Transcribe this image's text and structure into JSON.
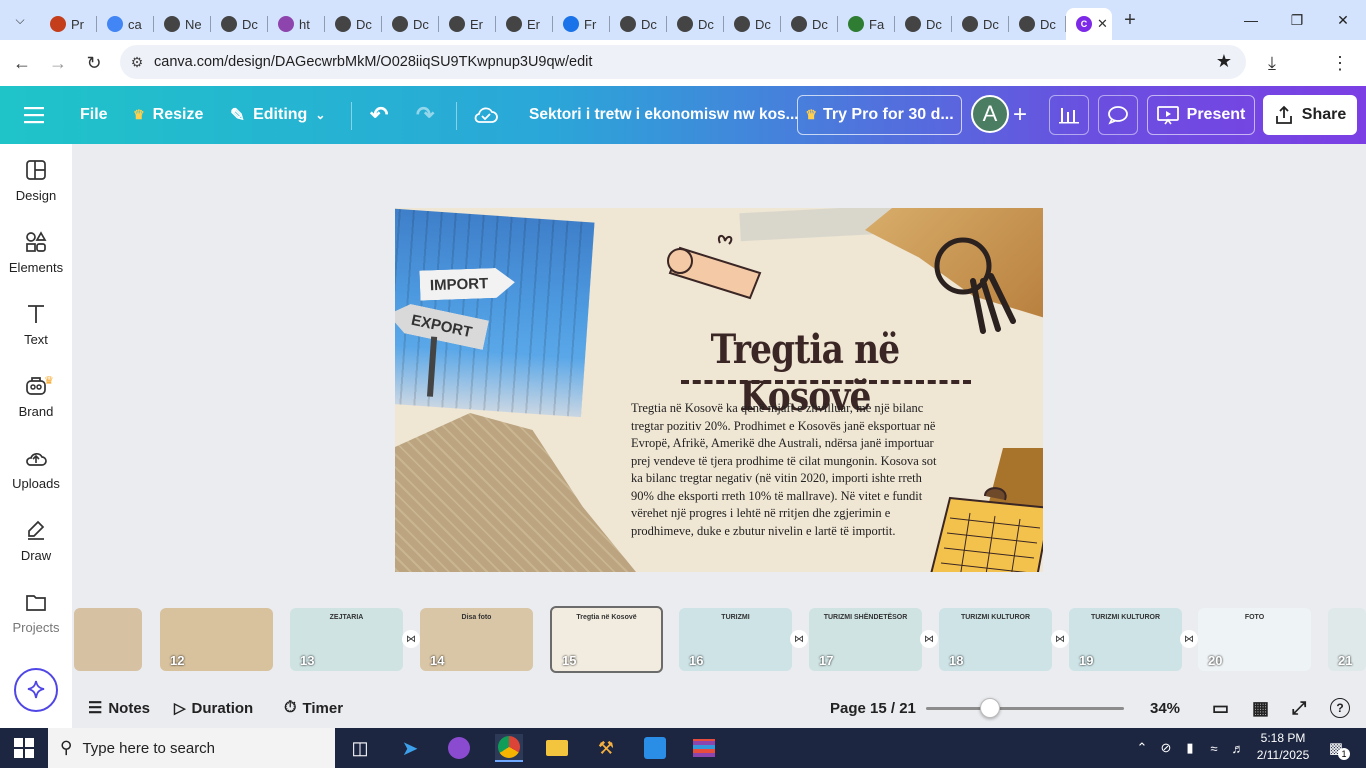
{
  "browser": {
    "tabs": [
      {
        "label": "Pr",
        "icon": "powerpoint-icon",
        "color": "#c43e1c"
      },
      {
        "label": "ca",
        "icon": "google-icon",
        "color": "#4285f4"
      },
      {
        "label": "Ne",
        "icon": "web-icon",
        "color": "#444444"
      },
      {
        "label": "Dc",
        "icon": "web-icon",
        "color": "#444444"
      },
      {
        "label": "ht",
        "icon": "triangle-icon",
        "color": "#8e44ad"
      },
      {
        "label": "Dc",
        "icon": "web-icon",
        "color": "#444444"
      },
      {
        "label": "Dc",
        "icon": "web-icon",
        "color": "#444444"
      },
      {
        "label": "Er",
        "icon": "web-icon",
        "color": "#444444"
      },
      {
        "label": "Er",
        "icon": "web-icon",
        "color": "#444444"
      },
      {
        "label": "Fr",
        "icon": "heart-icon",
        "color": "#1a73e8"
      },
      {
        "label": "Dc",
        "icon": "web-icon",
        "color": "#444444"
      },
      {
        "label": "Dc",
        "icon": "web-icon",
        "color": "#444444"
      },
      {
        "label": "Dc",
        "icon": "web-icon",
        "color": "#444444"
      },
      {
        "label": "Dc",
        "icon": "web-icon",
        "color": "#444444"
      },
      {
        "label": "Fa",
        "icon": "am-icon",
        "color": "#2e7d32"
      },
      {
        "label": "Dc",
        "icon": "web-icon",
        "color": "#444444"
      },
      {
        "label": "Dc",
        "icon": "web-icon",
        "color": "#444444"
      },
      {
        "label": "Dc",
        "icon": "web-icon",
        "color": "#444444"
      }
    ],
    "url": "canva.com/design/DAGecwrbMkM/O028iiqSU9TKwpnup3U9qw/edit"
  },
  "canva_header": {
    "file": "File",
    "resize": "Resize",
    "editing": "Editing",
    "doc_title": "Sektori i tretw i ekonomisw nw kos...",
    "try_pro": "Try Pro for 30 d...",
    "avatar": "A",
    "present": "Present",
    "share": "Share"
  },
  "sidebar": {
    "items": [
      {
        "label": "Design",
        "icon": "design-icon"
      },
      {
        "label": "Elements",
        "icon": "elements-icon"
      },
      {
        "label": "Text",
        "icon": "text-icon"
      },
      {
        "label": "Brand",
        "icon": "brand-icon"
      },
      {
        "label": "Uploads",
        "icon": "uploads-icon"
      },
      {
        "label": "Draw",
        "icon": "draw-icon"
      },
      {
        "label": "Projects",
        "icon": "projects-icon"
      }
    ]
  },
  "slide": {
    "title": "Tregtia në Kosovë",
    "body": "Tregtia në Kosovë ka qenë mjaft e zhvilluar, me një bilanc tregtar pozitiv 20%. Prodhimet e Kosovës janë eksportuar në Evropë, Afrikë, Amerikë dhe Australi, ndërsa janë importuar prej vendeve të tjera prodhime të cilat mungonin. Kosova sot ka bilanc tregtar negativ (në vitin 2020, importi ishte rreth 90% dhe eksporti rreth 10% të mallrave). Në vitet e fundit vërehet një progres i lehtë në rritjen dhe zgjerimin e prodhimeve, duke e zbutur nivelin e lartë të importit.",
    "sign_import": "IMPORT",
    "sign_export": "EXPORT"
  },
  "filmstrip": [
    {
      "num": "12",
      "title": ""
    },
    {
      "num": "13",
      "title": "ZEJTARIA"
    },
    {
      "num": "14",
      "title": "Disa foto"
    },
    {
      "num": "15",
      "title": "Tregtia në Kosovë"
    },
    {
      "num": "16",
      "title": "TURIZMI"
    },
    {
      "num": "17",
      "title": "TURIZMI SHËNDETËSOR"
    },
    {
      "num": "18",
      "title": "TURIZMI KULTUROR"
    },
    {
      "num": "19",
      "title": "TURIZMI KULTUROR"
    },
    {
      "num": "20",
      "title": "FOTO"
    },
    {
      "num": "21",
      "title": ""
    }
  ],
  "bottom": {
    "notes": "Notes",
    "duration": "Duration",
    "timer": "Timer",
    "page": "Page 15 / 21",
    "zoom": "34%",
    "zoom_fraction": 0.34
  },
  "taskbar": {
    "search_placeholder": "Type here to search",
    "time": "5:18 PM",
    "date": "2/11/2025",
    "notifications": "1"
  },
  "colors": {
    "canva_gradient_start": "#1fc4c9",
    "canva_gradient_end": "#7b3fe4",
    "slide_bg": "#efe6d4",
    "title_color": "#3a2624"
  }
}
